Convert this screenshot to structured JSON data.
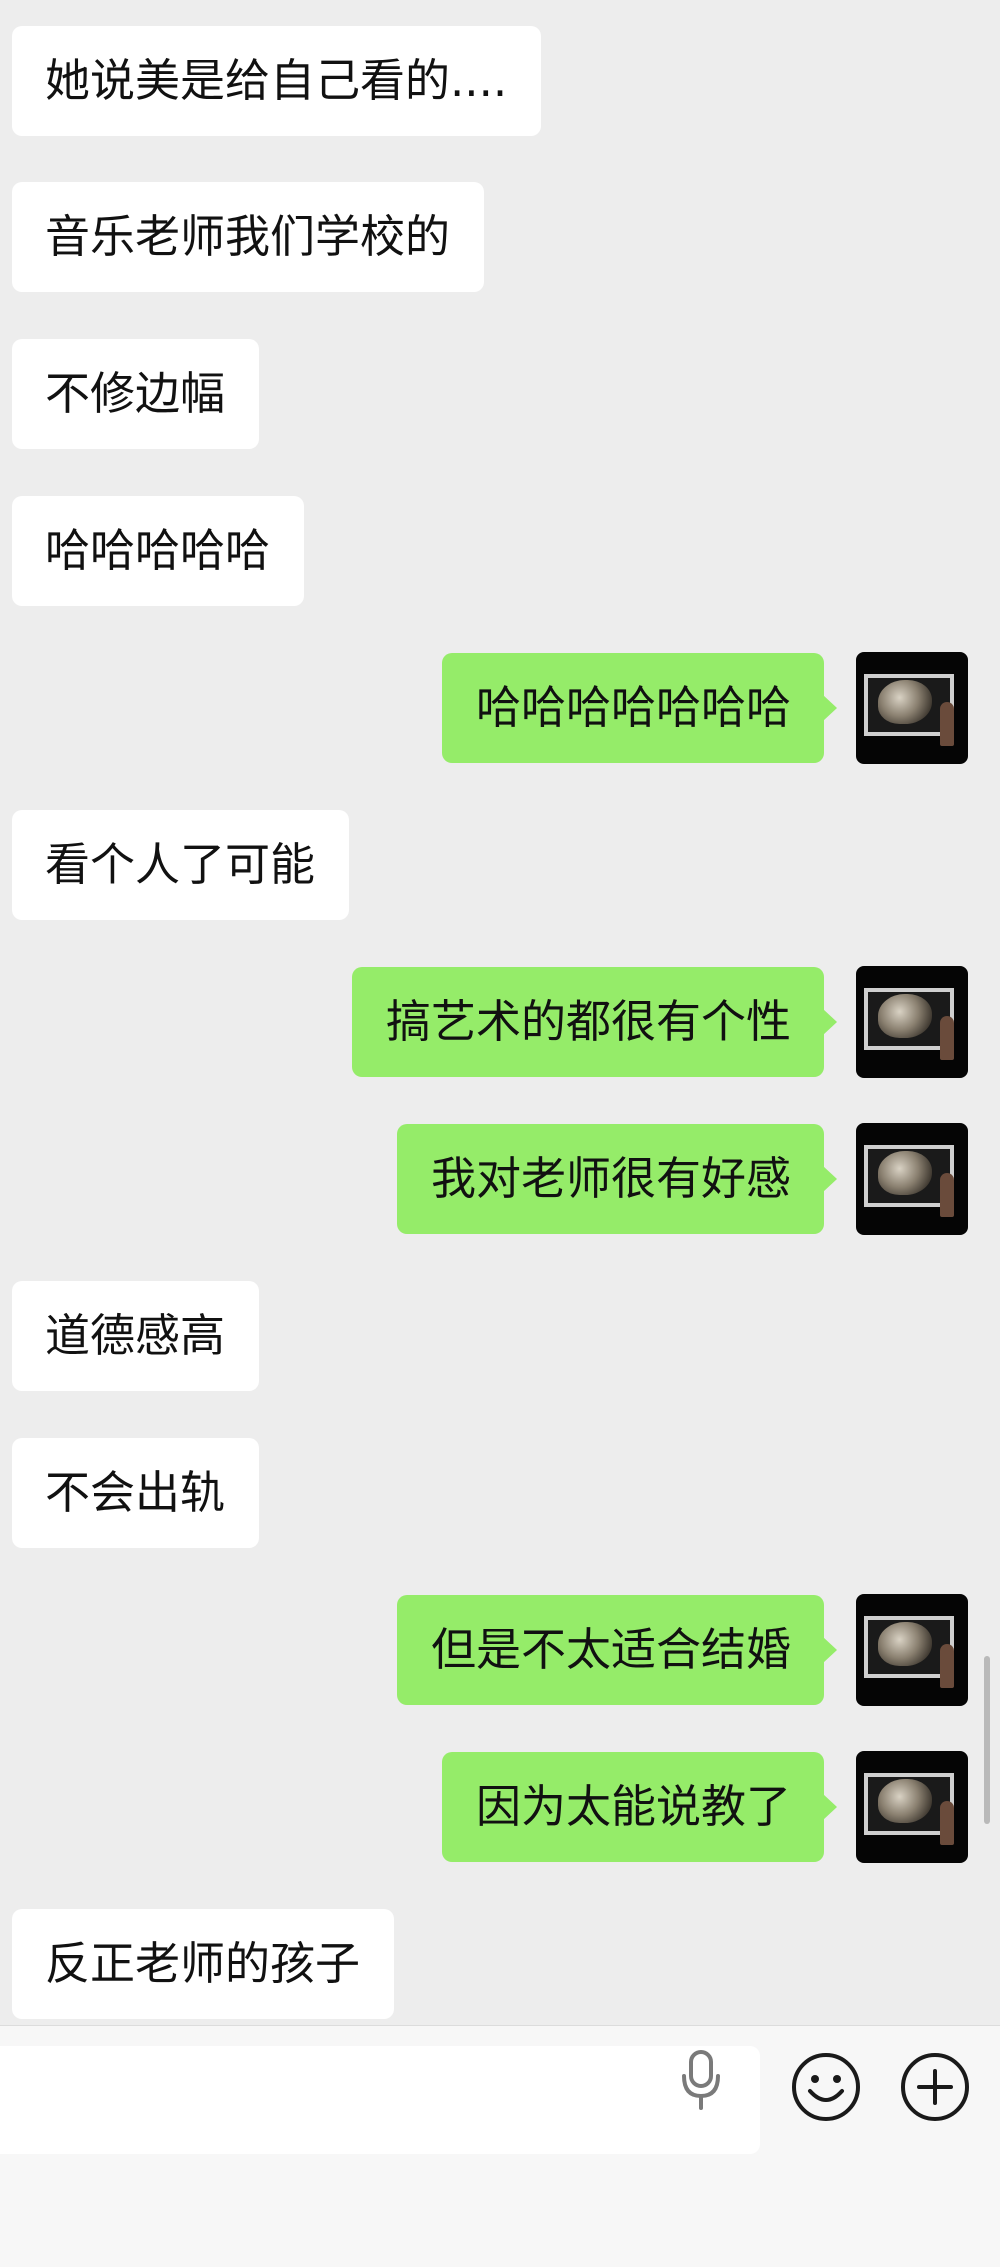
{
  "messages": [
    {
      "side": "in",
      "text": "她说美是给自己看的...."
    },
    {
      "side": "in",
      "text": "音乐老师我们学校的"
    },
    {
      "side": "in",
      "text": "不修边幅"
    },
    {
      "side": "in",
      "text": "哈哈哈哈哈"
    },
    {
      "side": "out",
      "text": "哈哈哈哈哈哈哈"
    },
    {
      "side": "in",
      "text": "看个人了可能"
    },
    {
      "side": "out",
      "text": "搞艺术的都很有个性"
    },
    {
      "side": "out",
      "text": "我对老师很有好感"
    },
    {
      "side": "in",
      "text": "道德感高"
    },
    {
      "side": "in",
      "text": "不会出轨"
    },
    {
      "side": "out",
      "text": "但是不太适合结婚"
    },
    {
      "side": "out",
      "text": "因为太能说教了"
    },
    {
      "side": "in",
      "text": "反正老师的孩子"
    }
  ],
  "input_bar": {
    "input_value": "",
    "mic_icon": "mic-icon",
    "emoji_icon": "emoji-icon",
    "plus_icon": "plus-icon"
  },
  "colors": {
    "background": "#ededed",
    "incoming_bubble": "#ffffff",
    "outgoing_bubble": "#95ec69",
    "text": "#111111"
  }
}
